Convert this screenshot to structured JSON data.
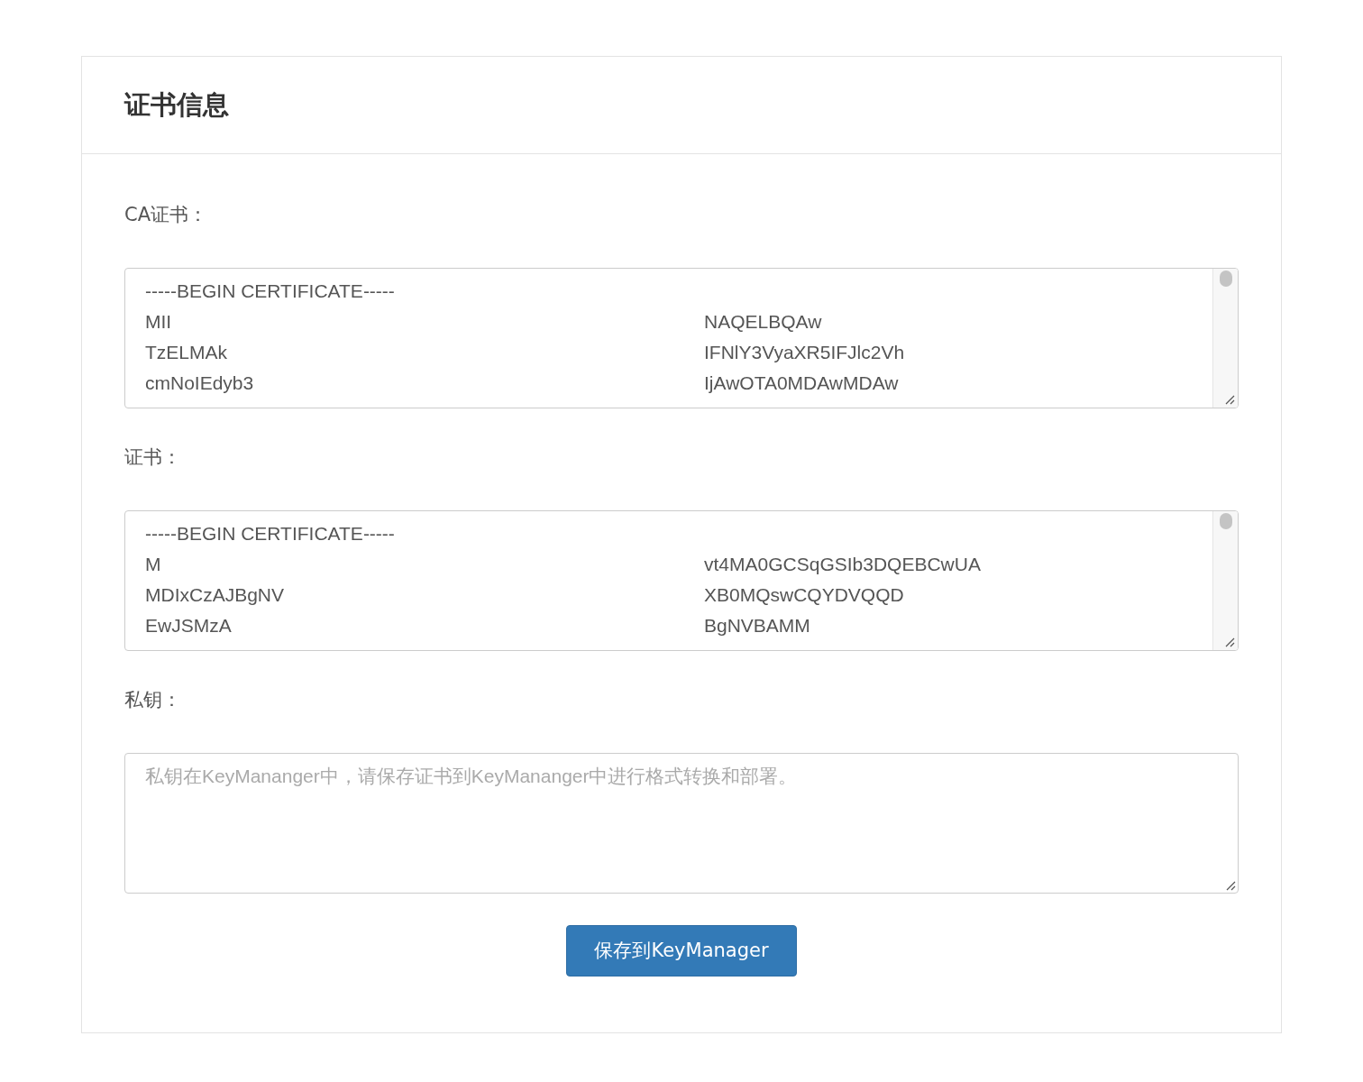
{
  "panel": {
    "title": "证书信息"
  },
  "fields": [
    {
      "kind": "certificate",
      "label": "CA证书：",
      "lines": [
        {
          "left": "-----BEGIN CERTIFICATE-----"
        },
        {
          "left": "MII",
          "right": "NAQELBQAw"
        },
        {
          "left": "TzELMAk",
          "right": "IFNlY3VyaXR5IFJlc2Vh"
        },
        {
          "left": "cmNoIEdyb3",
          "right": "IjAwOTA0MDAwMDAw"
        }
      ]
    },
    {
      "kind": "certificate",
      "label": "证书：",
      "lines": [
        {
          "left": "-----BEGIN CERTIFICATE-----"
        },
        {
          "left": "M",
          "right": "vt4MA0GCSqGSIb3DQEBCwUA"
        },
        {
          "left": "MDIxCzAJBgNV",
          "right": "XB0MQswCQYDVQQD"
        },
        {
          "left": "EwJSMzA",
          "right": "BgNVBAMM"
        }
      ]
    },
    {
      "kind": "textarea",
      "label": "私钥：",
      "placeholder": "私钥在KeyMananger中，请保存证书到KeyMananger中进行格式转换和部署。"
    }
  ],
  "button": {
    "label": "保存到KeyManager"
  }
}
